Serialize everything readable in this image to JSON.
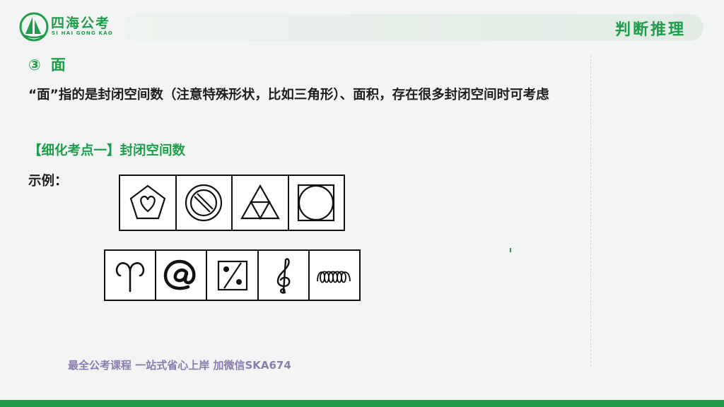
{
  "brand": {
    "name": "四海公考",
    "subtitle": "SI HAI GONG KAO",
    "color": "#1f9d4a"
  },
  "header": {
    "section": "判断推理"
  },
  "content": {
    "heading_num": "③",
    "heading": "面",
    "paragraph": "“面”指的是封闭空间数（注意特殊形状，比如三角形）、面积，存在很多封闭空间时可考虑",
    "subheading": "【细化考点一】封闭空间数",
    "example_label": "示例："
  },
  "figures": {
    "row1": [
      "pentagon-heart-icon",
      "circle-slash-icon",
      "nested-triangles-icon",
      "circle-in-square-icon"
    ],
    "row2": [
      "aries-symbol-icon",
      "at-sign-icon",
      "percent-box-icon",
      "treble-clef-icon",
      "coil-icon"
    ]
  },
  "watermark": "最全公考课程 一站式省心上岸 加微信SKA674"
}
